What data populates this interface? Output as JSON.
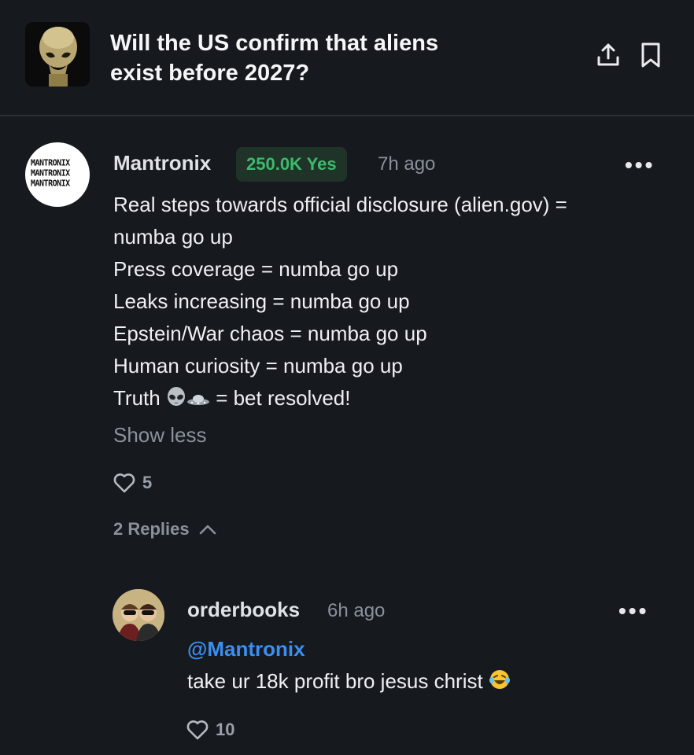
{
  "market": {
    "title_line1": "Will the US confirm that aliens",
    "title_line2": "exist before 2027?",
    "share_icon": "share-icon",
    "bookmark_icon": "bookmark-icon"
  },
  "comment": {
    "avatar_text": [
      "MANTRONIX",
      "MANTRONIX",
      "MANTRONIX"
    ],
    "username": "Mantronix",
    "position_badge": "250.0K Yes",
    "time": "7h ago",
    "more": "•••",
    "lines": [
      "Real steps towards official disclosure (alien.gov) =",
      "numba go up",
      "Press coverage = numba go up",
      "Leaks increasing = numba go up",
      "Epstein/War chaos = numba go up",
      "Human curiosity = numba go up"
    ],
    "last_line_prefix": "Truth",
    "last_line_emojis": [
      "alien-emoji",
      "ufo-emoji"
    ],
    "last_line_suffix": "= bet resolved!",
    "show_less": "Show less",
    "likes": "5",
    "replies_label": "2 Replies"
  },
  "reply": {
    "username": "orderbooks",
    "time": "6h ago",
    "more": "•••",
    "mention": "@Mantronix",
    "text": "take ur 18k profit bro jesus christ",
    "emoji": "laughing-tears-emoji",
    "likes": "10"
  },
  "colors": {
    "background": "#16191e",
    "badge_bg": "#1f3328",
    "badge_text": "#3dba6b",
    "mention": "#3b8ff0",
    "muted": "#8b919a"
  }
}
